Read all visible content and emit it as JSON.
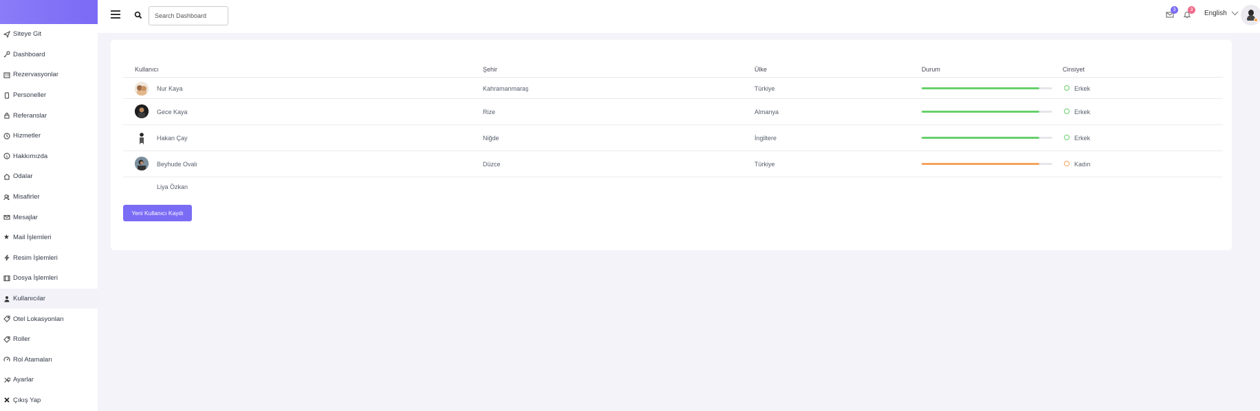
{
  "sidebar": {
    "items": [
      {
        "label": "Siteye Git",
        "icon": "send-icon"
      },
      {
        "label": "Dashboard",
        "icon": "key-icon"
      },
      {
        "label": "Rezervasyonlar",
        "icon": "calendar-icon"
      },
      {
        "label": "Personeller",
        "icon": "phone-icon"
      },
      {
        "label": "Referanslar",
        "icon": "lock-icon"
      },
      {
        "label": "Hizmetler",
        "icon": "clock-icon"
      },
      {
        "label": "Hakkımızda",
        "icon": "info-icon"
      },
      {
        "label": "Odalar",
        "icon": "home-icon"
      },
      {
        "label": "Misafirler",
        "icon": "users-icon"
      },
      {
        "label": "Mesajlar",
        "icon": "mail-icon"
      },
      {
        "label": "Mail İşlemleri",
        "icon": "star-icon"
      },
      {
        "label": "Resim İşlemleri",
        "icon": "bolt-icon"
      },
      {
        "label": "Dosya İşlemleri",
        "icon": "film-icon"
      },
      {
        "label": "Kullanıcılar",
        "icon": "user-icon"
      },
      {
        "label": "Otel Lokasyonları",
        "icon": "tag-icon"
      },
      {
        "label": "Roller",
        "icon": "tag-icon"
      },
      {
        "label": "Rol Atamaları",
        "icon": "gauge-icon"
      },
      {
        "label": "Ayarlar",
        "icon": "tools-icon"
      },
      {
        "label": "Çıkış Yap",
        "icon": "close-icon"
      }
    ],
    "active_index": 13
  },
  "topbar": {
    "search_placeholder": "Search Dashboard",
    "mail_badge": "3",
    "bell_badge": "3",
    "language": "English",
    "colors": {
      "mail_badge": "#7b6cf6",
      "bell_badge": "#f06a8a"
    }
  },
  "table": {
    "headers": {
      "user": "Kullanıcı",
      "city": "Şehir",
      "country": "Ülke",
      "status": "Durum",
      "gender": "Cinsiyet"
    },
    "rows": [
      {
        "name": "Nur Kaya",
        "city": "Kahramanmaraş",
        "country": "Türkiye",
        "status_pct": 90,
        "status_color": "#66d06a",
        "gender": "Erkek",
        "gender_color": "#66d06a"
      },
      {
        "name": "Gece Kaya",
        "city": "Rize",
        "country": "Almanya",
        "status_pct": 90,
        "status_color": "#66d06a",
        "gender": "Erkek",
        "gender_color": "#66d06a"
      },
      {
        "name": "Hakan Çay",
        "city": "Niğde",
        "country": "İngiltere",
        "status_pct": 90,
        "status_color": "#66d06a",
        "gender": "Erkek",
        "gender_color": "#66d06a"
      },
      {
        "name": "Beyhude Ovalı",
        "city": "Düzce",
        "country": "Türkiye",
        "status_pct": 90,
        "status_color": "#f3a25a",
        "gender": "Kadın",
        "gender_color": "#f3a25a"
      },
      {
        "name": "Liya Özkan",
        "city": "",
        "country": "",
        "status_pct": null,
        "status_color": "",
        "gender": "",
        "gender_color": ""
      }
    ]
  },
  "actions": {
    "new_user_label": "Yeni Kullanıcı Kaydı"
  },
  "colors": {
    "accent": "#7b6cf6",
    "background": "#f3f3f9"
  }
}
